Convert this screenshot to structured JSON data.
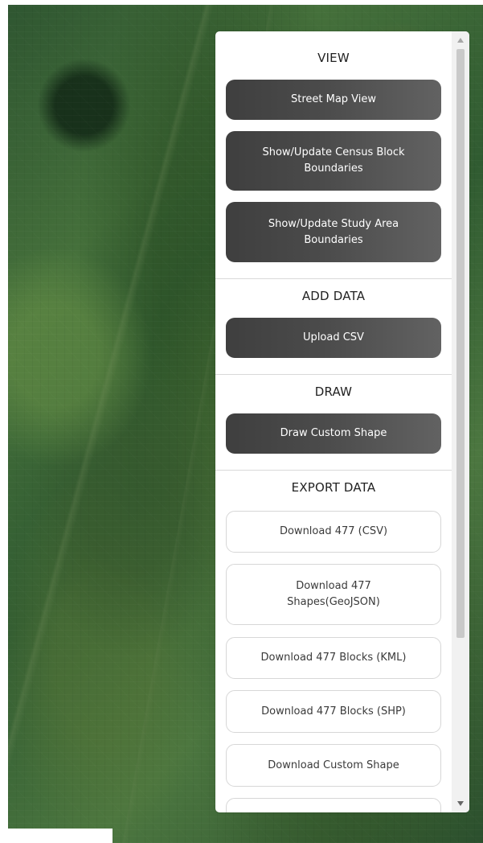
{
  "map": {
    "background_style": "satellite imagery"
  },
  "panel": {
    "sections": {
      "view": {
        "title": "VIEW",
        "buttons": {
          "street_map": "Street Map View",
          "census_blocks": "Show/Update Census Block\nBoundaries",
          "study_area": "Show/Update Study Area\nBoundaries"
        }
      },
      "add_data": {
        "title": "ADD DATA",
        "buttons": {
          "upload_csv": "Upload CSV"
        }
      },
      "draw": {
        "title": "DRAW",
        "buttons": {
          "draw_custom_shape": "Draw Custom Shape"
        }
      },
      "export_data": {
        "title": "EXPORT DATA",
        "buttons": {
          "download_477_csv": "Download 477 (CSV)",
          "download_477_shapes": "Download 477\nShapes(GeoJSON)",
          "download_477_kml": "Download 477 Blocks (KML)",
          "download_477_shp": "Download 477 Blocks (SHP)",
          "download_custom_shape": "Download Custom Shape"
        }
      }
    },
    "scroll": {
      "up_icon": "chevron-up-icon",
      "down_icon": "chevron-down-icon"
    },
    "colors": {
      "dark_button_start": "#3f3f3f",
      "dark_button_end": "#626262",
      "light_button_border": "#d7d7d7",
      "panel_background": "#ffffff",
      "scrollbar_track": "#f1f1f1",
      "scrollbar_thumb": "#c9c9c9"
    }
  }
}
